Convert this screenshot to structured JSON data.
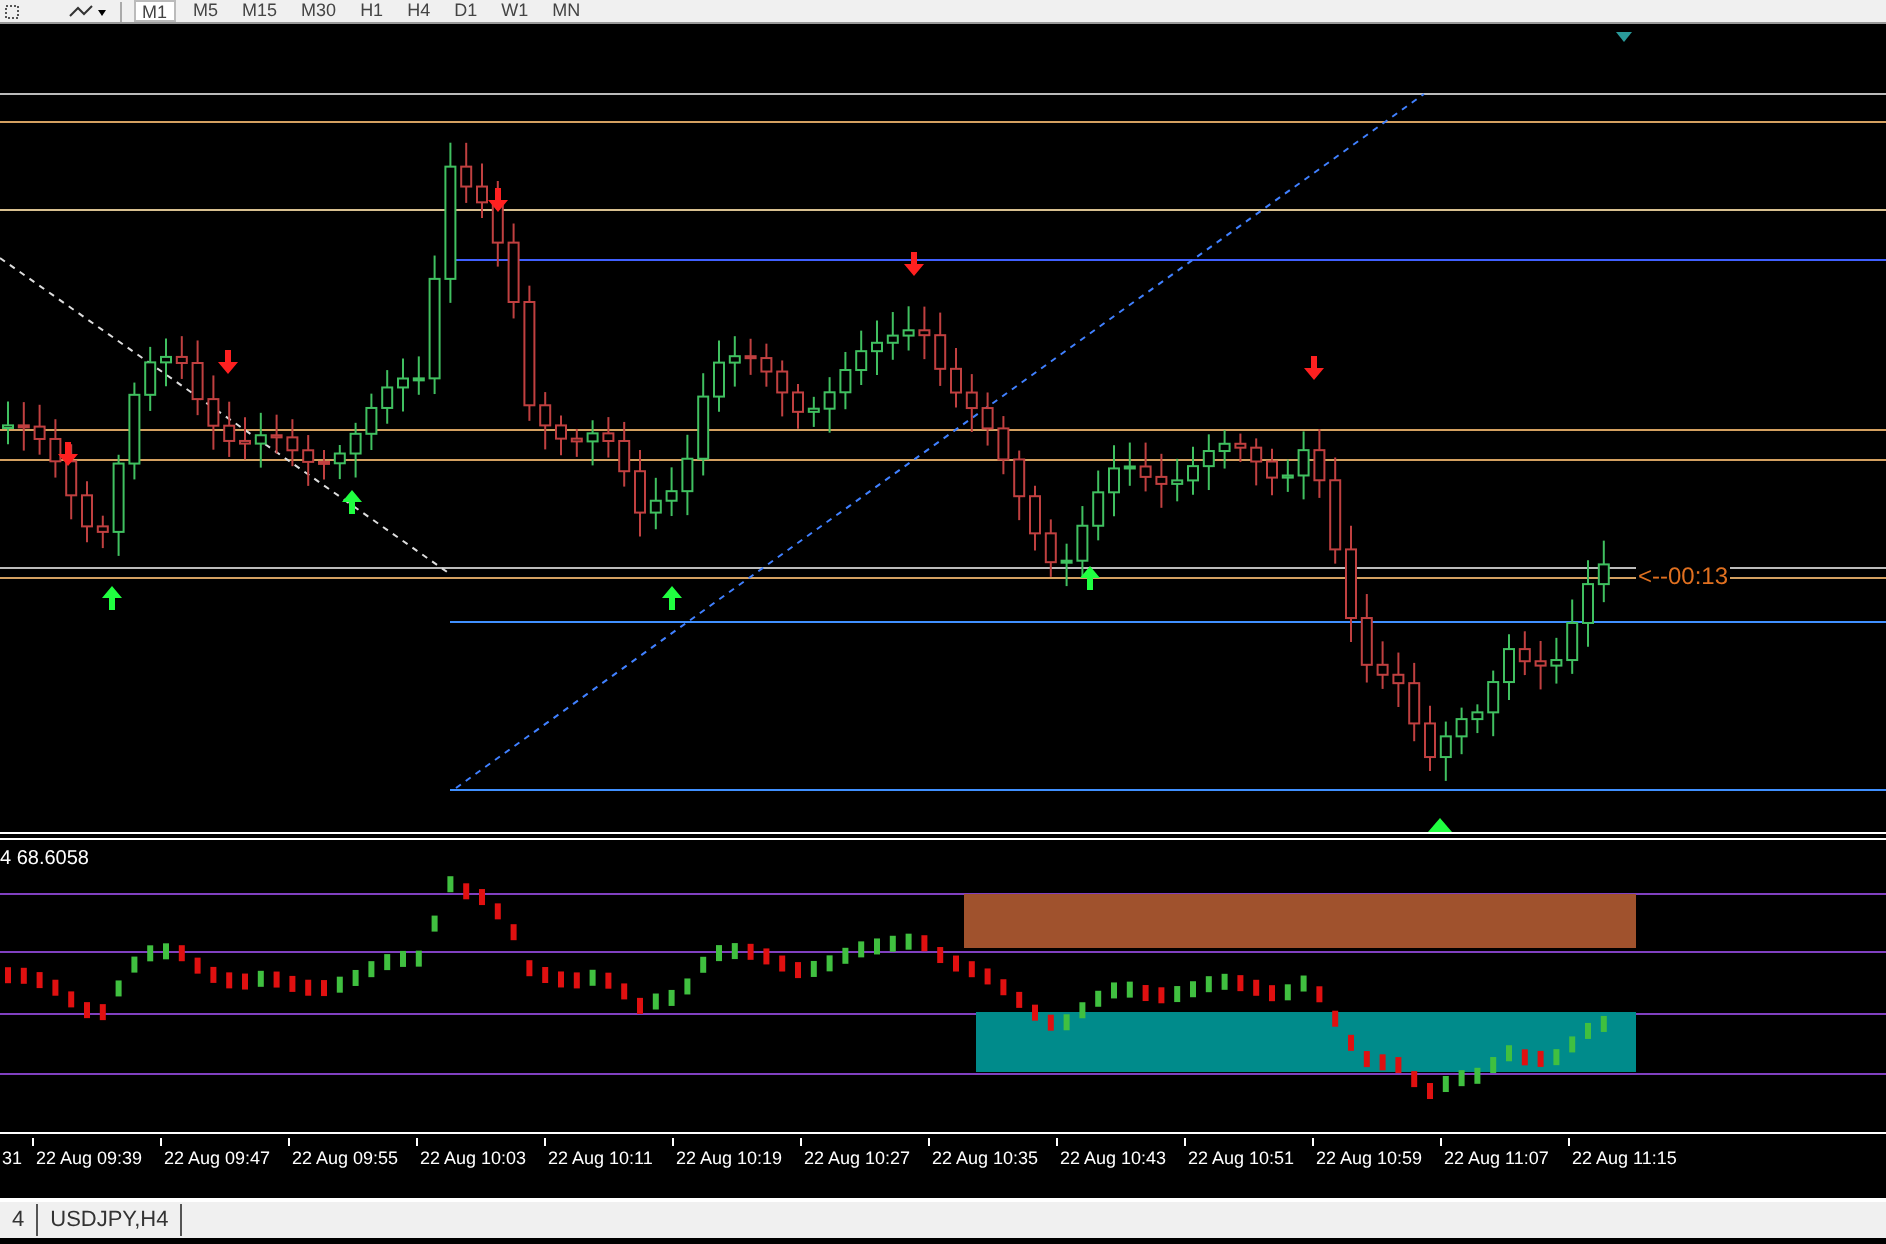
{
  "toolbar": {
    "timeframes": [
      {
        "label": "M1",
        "selected": true
      },
      {
        "label": "M5",
        "selected": false
      },
      {
        "label": "M15",
        "selected": false
      },
      {
        "label": "M30",
        "selected": false
      },
      {
        "label": "H1",
        "selected": false
      },
      {
        "label": "H4",
        "selected": false
      },
      {
        "label": "D1",
        "selected": false
      },
      {
        "label": "W1",
        "selected": false
      },
      {
        "label": "MN",
        "selected": false
      }
    ]
  },
  "main_chart": {
    "timer_label": "<--00:13"
  },
  "indicator": {
    "value_label": "4 68.6058"
  },
  "time_axis": {
    "labels": [
      "31",
      "22 Aug 09:39",
      "22 Aug 09:47",
      "22 Aug 09:55",
      "22 Aug 10:03",
      "22 Aug 10:11",
      "22 Aug 10:19",
      "22 Aug 10:27",
      "22 Aug 10:35",
      "22 Aug 10:43",
      "22 Aug 10:51",
      "22 Aug 10:59",
      "22 Aug 11:07",
      "22 Aug 11:15"
    ]
  },
  "chart_tabs": [
    {
      "label": "4"
    },
    {
      "label": "USDJPY,H4"
    }
  ]
}
